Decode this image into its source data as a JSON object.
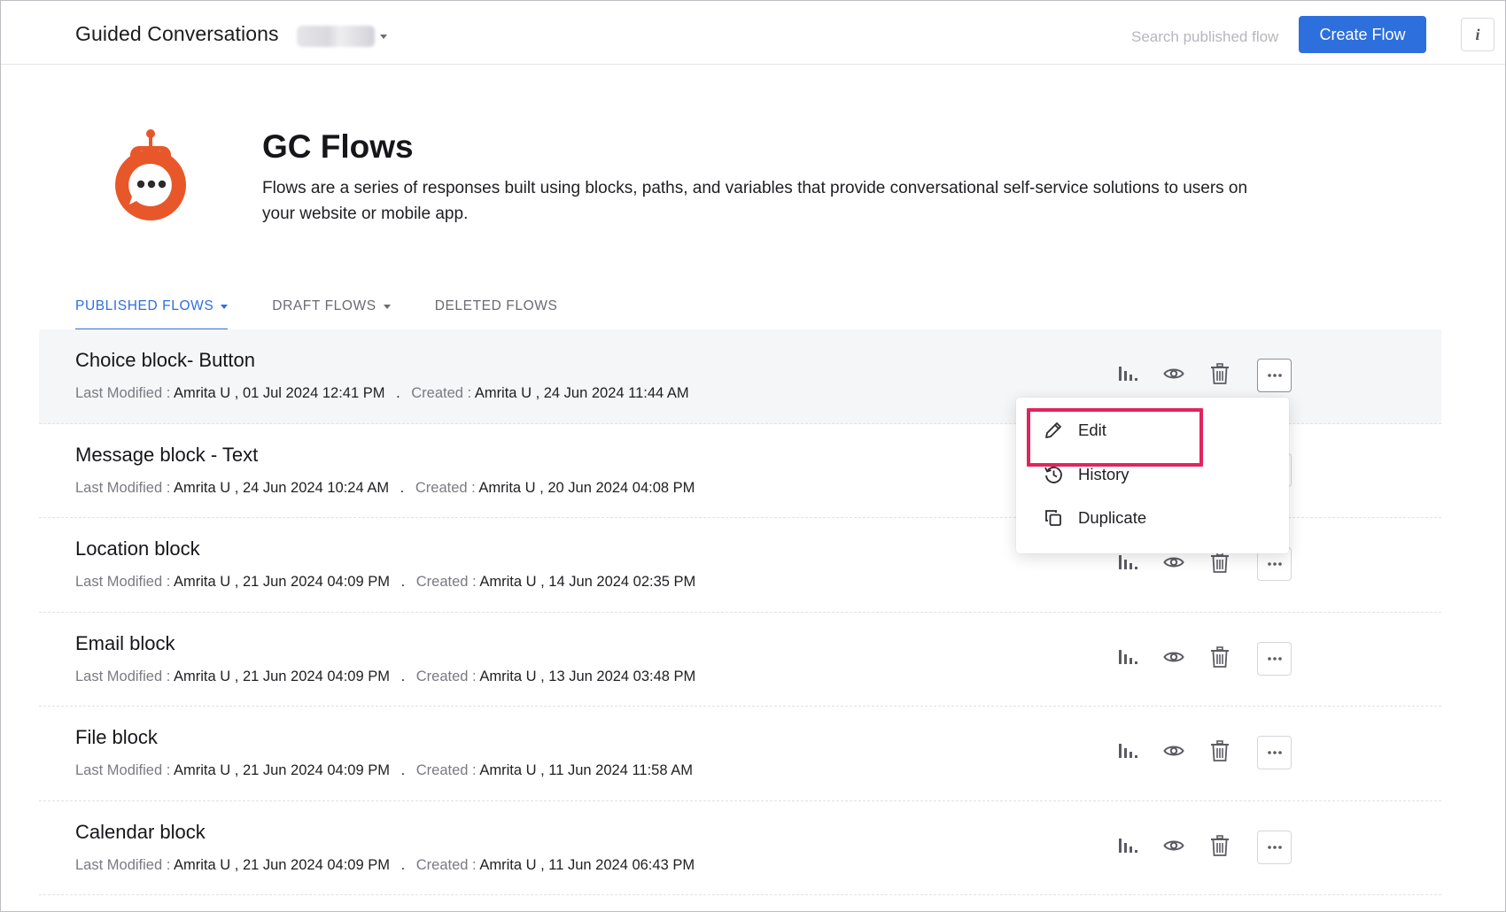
{
  "header": {
    "app_title": "Guided Conversations",
    "portal_selector": "",
    "search_placeholder": "Search published flow",
    "create_button": "Create Flow",
    "info_button": "i"
  },
  "hero": {
    "title": "GC Flows",
    "description": "Flows are a series of responses built using blocks, paths, and variables that provide conversational self-service solutions to users on your website or mobile app.",
    "logo_icon": "chatbot-icon",
    "accent_color": "#e8572a"
  },
  "tabs": [
    {
      "label": "PUBLISHED FLOWS",
      "active": true,
      "has_dropdown": true
    },
    {
      "label": "DRAFT FLOWS",
      "active": false,
      "has_dropdown": true
    },
    {
      "label": "DELETED FLOWS",
      "active": false,
      "has_dropdown": false
    }
  ],
  "labels": {
    "last_modified": "Last Modified :",
    "created": "Created :",
    "separator": "."
  },
  "flows": [
    {
      "name": "Choice block- Button",
      "modified_by": "Amrita U",
      "modified_at": "01 Jul 2024 12:41 PM",
      "created_by": "Amrita U",
      "created_at": "24 Jun 2024 11:44 AM"
    },
    {
      "name": "Message block - Text",
      "modified_by": "Amrita U",
      "modified_at": "24 Jun 2024 10:24 AM",
      "created_by": "Amrita U",
      "created_at": "20 Jun 2024 04:08 PM"
    },
    {
      "name": "Location block",
      "modified_by": "Amrita U",
      "modified_at": "21 Jun 2024 04:09 PM",
      "created_by": "Amrita U",
      "created_at": "14 Jun 2024 02:35 PM"
    },
    {
      "name": "Email block",
      "modified_by": "Amrita U",
      "modified_at": "21 Jun 2024 04:09 PM",
      "created_by": "Amrita U",
      "created_at": "13 Jun 2024 03:48 PM"
    },
    {
      "name": "File block",
      "modified_by": "Amrita U",
      "modified_at": "21 Jun 2024 04:09 PM",
      "created_by": "Amrita U",
      "created_at": "11 Jun 2024 11:58 AM"
    },
    {
      "name": "Calendar block",
      "modified_by": "Amrita U",
      "modified_at": "21 Jun 2024 04:09 PM",
      "created_by": "Amrita U",
      "created_at": "11 Jun 2024 06:43 PM"
    }
  ],
  "row_actions": [
    "stats-icon",
    "eye-icon",
    "trash-icon",
    "more-icon"
  ],
  "menu": {
    "items": [
      {
        "label": "Edit",
        "icon": "pencil-icon",
        "highlighted": true
      },
      {
        "label": "History",
        "icon": "history-icon",
        "highlighted": false
      },
      {
        "label": "Duplicate",
        "icon": "duplicate-icon",
        "highlighted": false
      }
    ]
  },
  "colors": {
    "primary": "#2d6fdc",
    "highlight_box": "#e0245e"
  }
}
